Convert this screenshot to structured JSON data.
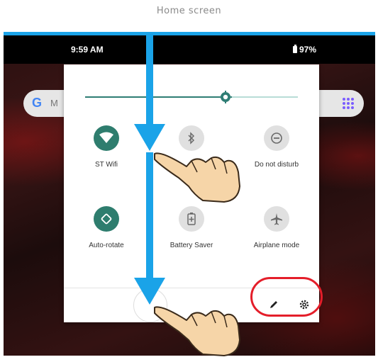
{
  "caption": "Home screen",
  "status_bar": {
    "time": "9:59 AM",
    "battery": "97%"
  },
  "search": {
    "hint": "M"
  },
  "quick_settings": {
    "tiles": [
      {
        "label": "ST Wifi",
        "icon": "wifi-icon",
        "state": "on"
      },
      {
        "label": "",
        "icon": "bluetooth-icon",
        "state": "off"
      },
      {
        "label": "Do not disturb",
        "icon": "do-not-disturb-icon",
        "state": "off"
      },
      {
        "label": "Auto-rotate",
        "icon": "auto-rotate-icon",
        "state": "on"
      },
      {
        "label": "Battery Saver",
        "icon": "battery-saver-icon",
        "state": "off"
      },
      {
        "label": "Airplane mode",
        "icon": "airplane-icon",
        "state": "off"
      }
    ],
    "brightness_level": 0.66
  },
  "colors": {
    "accent_blue": "#1aa3e8",
    "tile_active": "#2e7d6e",
    "highlight_red": "#e41e2a",
    "hand_fill": "#f6d5a8"
  }
}
